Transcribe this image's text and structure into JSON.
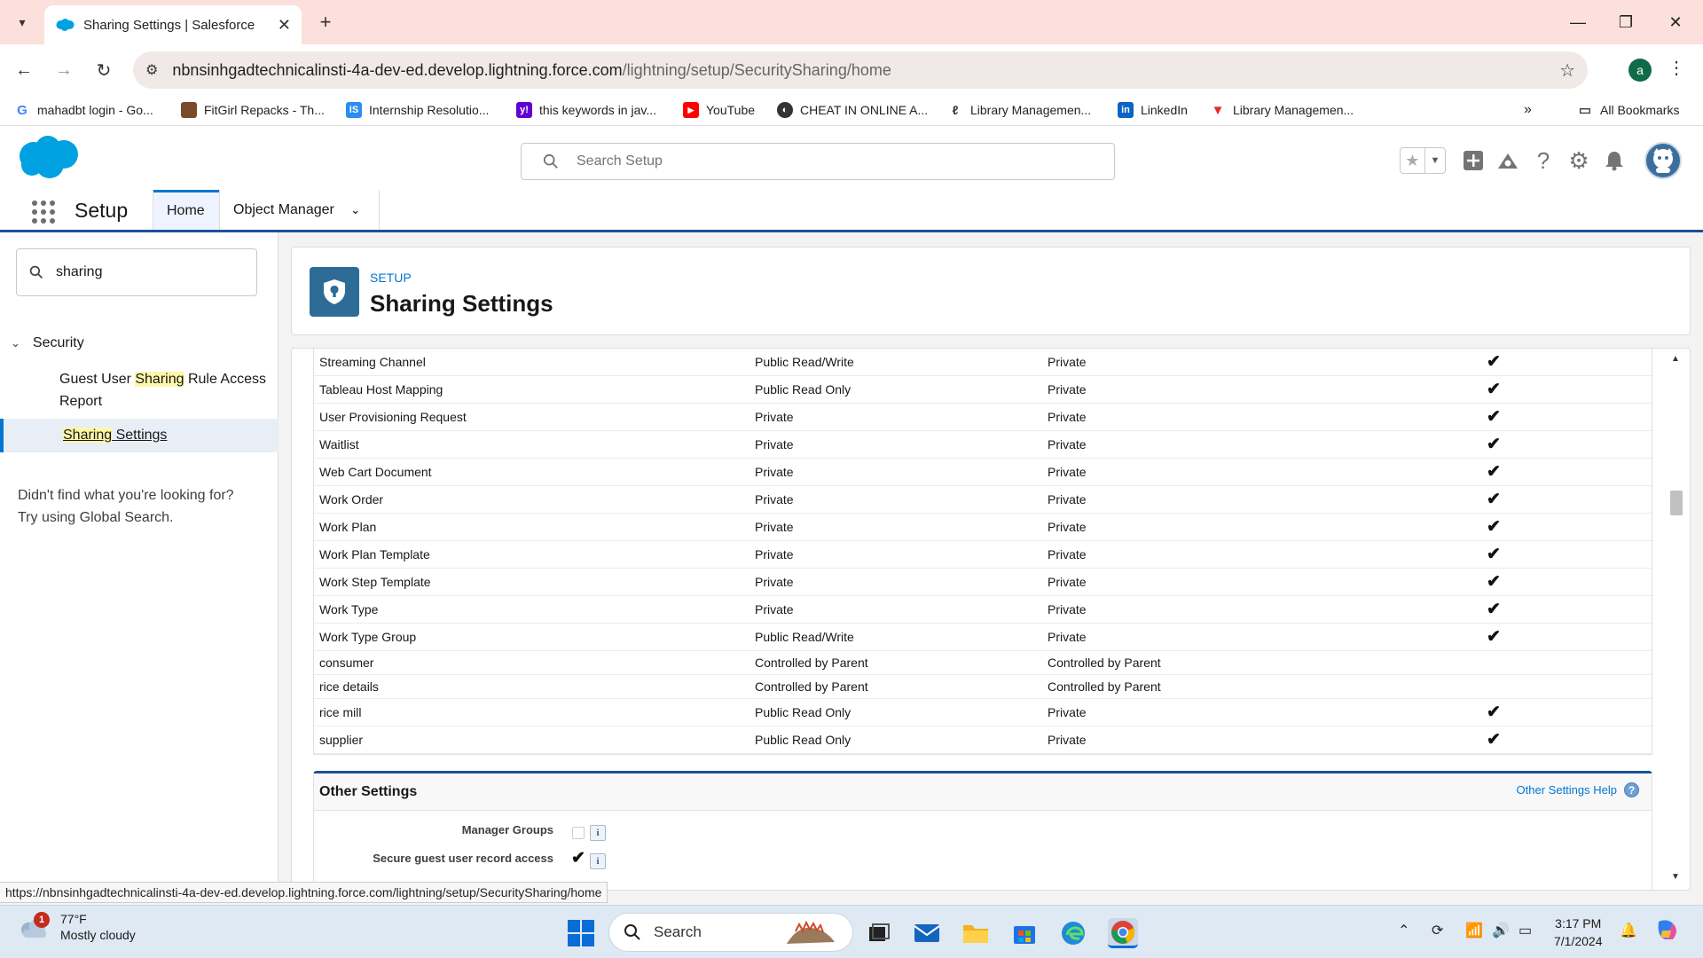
{
  "browser": {
    "tab_title": "Sharing Settings | Salesforce",
    "url_host": "nbnsinhgadtechnicalinsti-4a-dev-ed.develop.lightning.force.com",
    "url_path": "/lightning/setup/SecuritySharing/home",
    "profile_initial": "a",
    "status_url": "https://nbnsinhgadtechnicalinsti-4a-dev-ed.develop.lightning.force.com/lightning/setup/SecuritySharing/home",
    "bookmarks": [
      {
        "label": "mahadbt login - Go...",
        "icon": "google-icon"
      },
      {
        "label": "FitGirl Repacks - Th...",
        "icon": "fitgirl-icon"
      },
      {
        "label": "Internship Resolutio...",
        "icon": "is-icon"
      },
      {
        "label": "this keywords in jav...",
        "icon": "yahoo-icon"
      },
      {
        "label": "YouTube",
        "icon": "youtube-icon"
      },
      {
        "label": "CHEAT IN ONLINE A...",
        "icon": "globe-icon"
      },
      {
        "label": "Library Managemen...",
        "icon": "library-icon"
      },
      {
        "label": "LinkedIn",
        "icon": "linkedin-icon"
      },
      {
        "label": "Library Managemen...",
        "icon": "library-red-icon"
      }
    ],
    "all_bookmarks": "All Bookmarks"
  },
  "header": {
    "search_placeholder": "Search Setup"
  },
  "nav": {
    "app_name": "Setup",
    "tabs": [
      {
        "label": "Home"
      },
      {
        "label": "Object Manager"
      }
    ]
  },
  "sidebar": {
    "quickfind_value": "sharing",
    "section": "Security",
    "items": [
      {
        "pre": "Guest User ",
        "hl": "Sharing",
        "post": " Rule Access Report"
      },
      {
        "hl": "Sharing",
        "post": " Settings"
      }
    ],
    "notfound_line1": "Didn't find what you're looking for?",
    "notfound_line2": "Try using Global Search."
  },
  "page": {
    "eyebrow": "SETUP",
    "title": "Sharing Settings"
  },
  "table": {
    "rows": [
      {
        "object": "Streaming Channel",
        "internal": "Public Read/Write",
        "external": "Private",
        "hierarchy": "✔"
      },
      {
        "object": "Tableau Host Mapping",
        "internal": "Public Read Only",
        "external": "Private",
        "hierarchy": "✔"
      },
      {
        "object": "User Provisioning Request",
        "internal": "Private",
        "external": "Private",
        "hierarchy": "✔"
      },
      {
        "object": "Waitlist",
        "internal": "Private",
        "external": "Private",
        "hierarchy": "✔"
      },
      {
        "object": "Web Cart Document",
        "internal": "Private",
        "external": "Private",
        "hierarchy": "✔"
      },
      {
        "object": "Work Order",
        "internal": "Private",
        "external": "Private",
        "hierarchy": "✔"
      },
      {
        "object": "Work Plan",
        "internal": "Private",
        "external": "Private",
        "hierarchy": "✔"
      },
      {
        "object": "Work Plan Template",
        "internal": "Private",
        "external": "Private",
        "hierarchy": "✔"
      },
      {
        "object": "Work Step Template",
        "internal": "Private",
        "external": "Private",
        "hierarchy": "✔"
      },
      {
        "object": "Work Type",
        "internal": "Private",
        "external": "Private",
        "hierarchy": "✔"
      },
      {
        "object": "Work Type Group",
        "internal": "Public Read/Write",
        "external": "Private",
        "hierarchy": "✔"
      },
      {
        "object": "consumer",
        "internal": "Controlled by Parent",
        "external": "Controlled by Parent",
        "hierarchy": ""
      },
      {
        "object": "rice details",
        "internal": "Controlled by Parent",
        "external": "Controlled by Parent",
        "hierarchy": ""
      },
      {
        "object": "rice mill",
        "internal": "Public Read Only",
        "external": "Private",
        "hierarchy": "✔"
      },
      {
        "object": "supplier",
        "internal": "Public Read Only",
        "external": "Private",
        "hierarchy": "✔"
      }
    ]
  },
  "other_settings": {
    "title": "Other Settings",
    "help": "Other Settings Help",
    "items": [
      {
        "label": "Manager Groups",
        "checked": false
      },
      {
        "label": "Secure guest user record access",
        "checked": true
      }
    ],
    "checkmark": "✔",
    "info": "i"
  },
  "taskbar": {
    "temp": "77°F",
    "condition": "Mostly cloudy",
    "badge": "1",
    "search_label": "Search",
    "time": "3:17 PM",
    "date": "7/1/2024"
  },
  "colors": {
    "brand_blue": "#0176d3",
    "nav_underline": "#1b5297",
    "page_icon_bg": "#2c6c96",
    "tab_bar": "#fbe0dc"
  }
}
